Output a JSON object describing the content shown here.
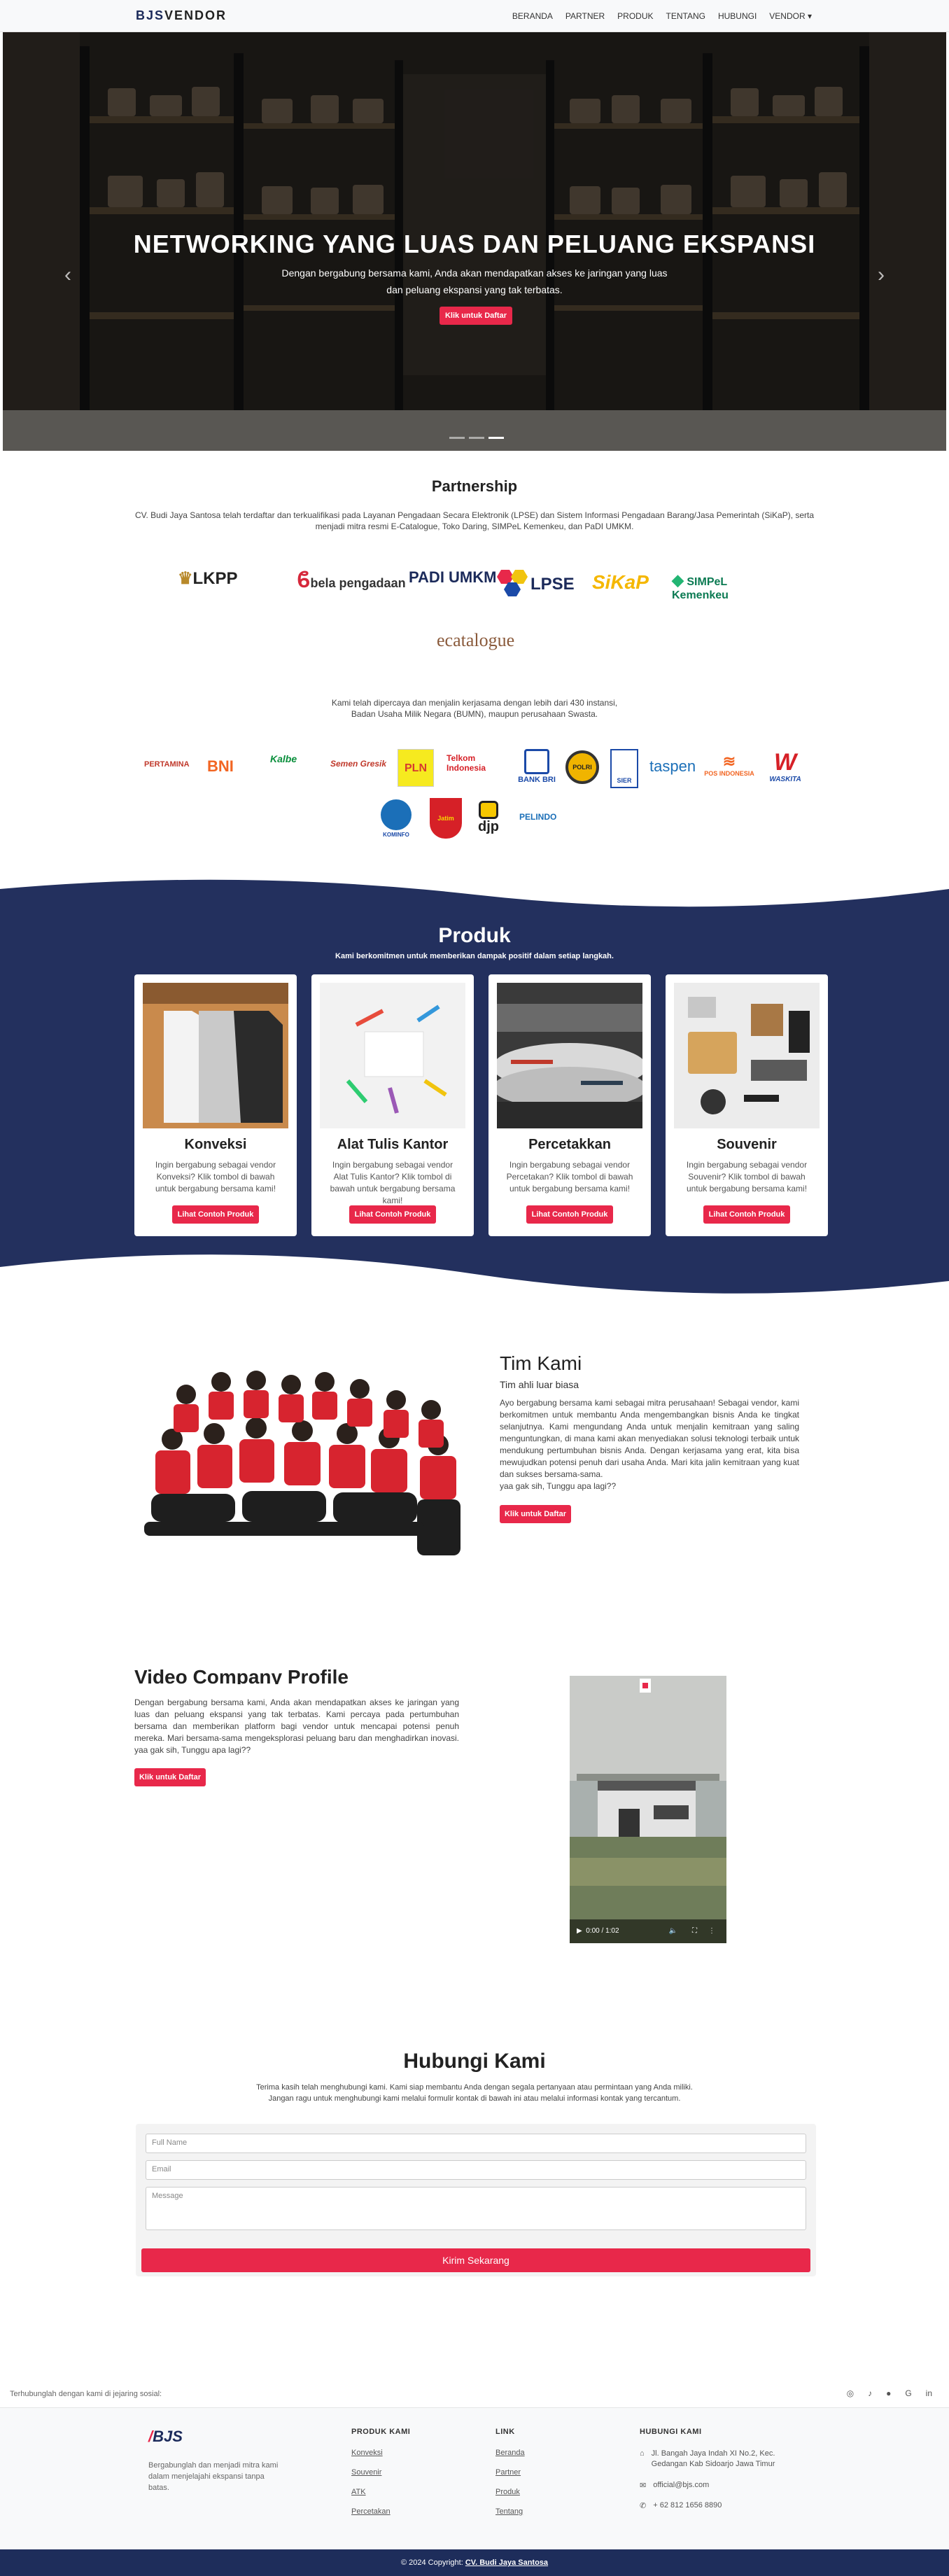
{
  "brand": {
    "prefix": "BJS",
    "suffix": "VENDOR"
  },
  "nav": [
    "BERANDA",
    "PARTNER",
    "PRODUK",
    "TENTANG",
    "HUBUNGI",
    "VENDOR ▾"
  ],
  "hero": {
    "title": "NETWORKING YANG LUAS DAN PELUANG EKSPANSI",
    "subtitle": "Dengan bergabung bersama kami, Anda akan mendapatkan akses ke jaringan yang luas dan peluang ekspansi yang tak terbatas.",
    "button": "Klik untuk Daftar",
    "prev": "‹",
    "next": "›"
  },
  "partnership": {
    "title": "Partnership",
    "desc": "CV. Budi Jaya Santosa telah terdaftar dan terkualifikasi pada Layanan Pengadaan Secara Elektronik (LPSE) dan Sistem Informasi Pengadaan Barang/Jasa Pemerintah (SiKaP), serta menjadi mitra resmi E-Catalogue, Toko Daring, SIMPeL Kemenkeu, dan PaDI UMKM.",
    "logos_a": [
      "LKPP",
      "bela pengadaan",
      "PADI UMKM",
      "LPSE",
      "SiKaP",
      "SIMPeL Kemenkeu",
      "ecatalogue"
    ],
    "trust": "Kami telah dipercaya dan menjalin kerjasama dengan lebih dari 430 instansi, Badan Usaha Milik Negara (BUMN), maupun perusahaan Swasta.",
    "logos_b": [
      "PERTAMINA",
      "BNI",
      "Kalbe",
      "Semen Gresik",
      "PLN",
      "Telkom Indonesia",
      "BANK BRI",
      "POLRI",
      "SIER",
      "taspen",
      "POS INDONESIA",
      "WASKITA",
      "KOMINFO",
      "Jatim",
      "djp",
      "PELINDO"
    ]
  },
  "produk": {
    "title": "Produk",
    "subtitle": "Kami berkomitmen untuk memberikan dampak positif dalam setiap langkah.",
    "items": [
      {
        "name": "Konveksi",
        "desc": "Ingin bergabung sebagai vendor Konveksi? Klik tombol di bawah untuk bergabung bersama kami!",
        "button": "Lihat Contoh Produk"
      },
      {
        "name": "Alat Tulis Kantor",
        "desc": "Ingin bergabung sebagai vendor Alat Tulis Kantor? Klik tombol di bawah untuk bergabung bersama kami!",
        "button": "Lihat Contoh Produk"
      },
      {
        "name": "Percetakkan",
        "desc": "Ingin bergabung sebagai vendor Percetakan? Klik tombol di bawah untuk bergabung bersama kami!",
        "button": "Lihat Contoh Produk"
      },
      {
        "name": "Souvenir",
        "desc": "Ingin bergabung sebagai vendor Souvenir? Klik tombol di bawah untuk bergabung bersama kami!",
        "button": "Lihat Contoh Produk"
      }
    ]
  },
  "tim": {
    "title": "Tim Kami",
    "subtitle": "Tim ahli luar biasa",
    "body": "Ayo bergabung bersama kami sebagai mitra perusahaan! Sebagai vendor, kami berkomitmen untuk membantu Anda mengembangkan bisnis Anda ke tingkat selanjutnya. Kami mengundang Anda untuk menjalin kemitraan yang saling menguntungkan, di mana kami akan menyediakan solusi teknologi terbaik untuk mendukung pertumbuhan bisnis Anda. Dengan kerjasama yang erat, kita bisa mewujudkan potensi penuh dari usaha Anda. Mari kita jalin kemitraan yang kuat dan sukses bersama-sama.",
    "ask": "yaa gak sih, Tunggu apa lagi??",
    "button": "Klik untuk Daftar"
  },
  "video": {
    "title": "Video Company Profile",
    "body": "Dengan bergabung bersama kami, Anda akan mendapatkan akses ke jaringan yang luas dan peluang ekspansi yang tak terbatas. Kami percaya pada pertumbuhan bersama dan memberikan platform bagi vendor untuk mencapai potensi penuh mereka. Mari bersama-sama mengeksplorasi peluang baru dan menghadirkan inovasi. yaa gak sih, Tunggu apa lagi??",
    "button": "Klik untuk Daftar",
    "time": "0:00 / 1:02"
  },
  "hubungi": {
    "title": "Hubungi Kami",
    "desc1": "Terima kasih telah menghubungi kami. Kami siap membantu Anda dengan segala pertanyaan atau permintaan yang Anda miliki.",
    "desc2": "Jangan ragu untuk menghubungi kami melalui formulir kontak di bawah ini atau melalui informasi kontak yang tercantum.",
    "ph_name": "Full Name",
    "ph_email": "Email",
    "ph_msg": "Message",
    "submit": "Kirim Sekarang"
  },
  "social": {
    "text": "Terhubunglah dengan kami di jejaring sosial:"
  },
  "footer": {
    "logo": "BJS",
    "tagline": "Bergabunglah dan menjadi mitra kami dalam menjelajahi ekspansi tanpa batas.",
    "col1_title": "PRODUK KAMI",
    "col1": [
      "Konveksi",
      "Souvenir",
      "ATK",
      "Percetakan"
    ],
    "col2_title": "LINK",
    "col2": [
      "Beranda",
      "Partner",
      "Produk",
      "Tentang"
    ],
    "col3_title": "HUBUNGI KAMI",
    "address": "Jl. Bangah Jaya Indah XI No.2, Kec. Gedangan Kab Sidoarjo Jawa Timur",
    "email": "official@bjs.com",
    "phone": "+ 62 812 1656 8890",
    "copyright": "© 2024 Copyright:",
    "company": "CV. Budi Jaya Santosa"
  },
  "colors": {
    "navy": "#23305e",
    "accent": "#e8284a"
  }
}
